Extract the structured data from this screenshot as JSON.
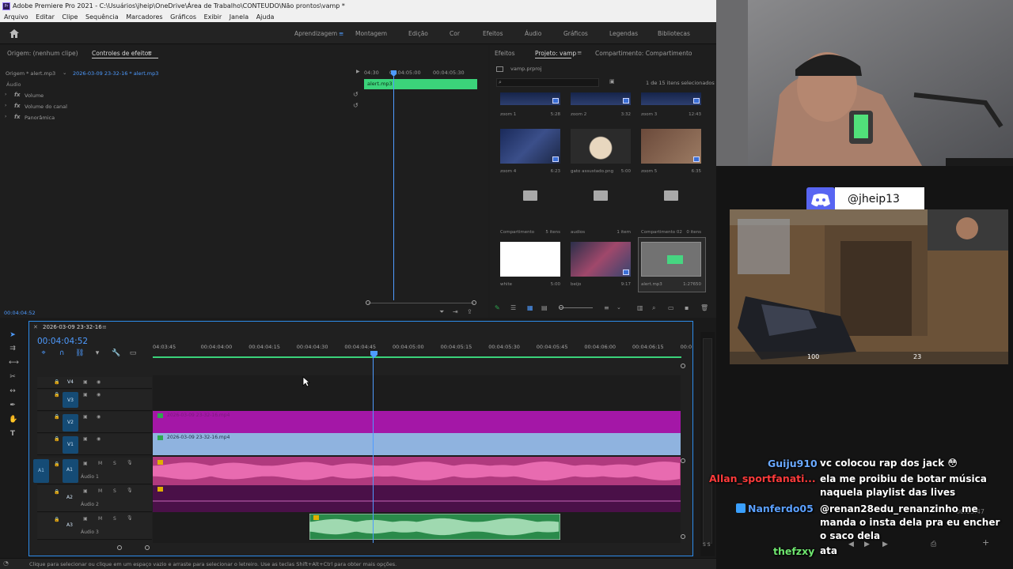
{
  "window": {
    "title": "Adobe Premiere Pro 2021 - C:\\Usuários\\jheip\\OneDrive\\Área de Trabalho\\CONTEUDO\\Não prontos\\vamp *",
    "icon": "Pr"
  },
  "menu": [
    "Arquivo",
    "Editar",
    "Clipe",
    "Sequência",
    "Marcadores",
    "Gráficos",
    "Exibir",
    "Janela",
    "Ajuda"
  ],
  "workspaces": {
    "items": [
      "Aprendizagem",
      "Montagem",
      "Edição",
      "Cor",
      "Efeitos",
      "Áudio",
      "Gráficos",
      "Legendas",
      "Bibliotecas"
    ],
    "active": "Aprendizagem"
  },
  "effect_controls": {
    "source_tab": "Origem: (nenhum clipe)",
    "active_tab": "Controles de efeitos",
    "source_label": "Origem * alert.mp3",
    "sequence_label": "2026-03-09 23-32-16 * alert.mp3",
    "section": "Áudio",
    "rows": [
      "Volume",
      "Volume do canal",
      "Panorâmica"
    ],
    "ruler": [
      "04:30",
      "00:04:05:00",
      "00:04:05:30"
    ],
    "clip_label": "alert.mp3",
    "timecode": "00:04:04:52"
  },
  "project": {
    "tabs": [
      "Efeitos",
      "Projeto: vamp",
      "Compartimento: Compartimento"
    ],
    "active_tab": "Projeto: vamp",
    "file": "vamp.prproj",
    "selection": "1 de 15 itens selecionados",
    "items": [
      {
        "name": "zoom 1",
        "meta": "5:28"
      },
      {
        "name": "zoom 2",
        "meta": "3:32"
      },
      {
        "name": "zoom 3",
        "meta": "12:43"
      },
      {
        "name": "zoom 4",
        "meta": "6:23"
      },
      {
        "name": "gato assustado.png",
        "meta": "5:00"
      },
      {
        "name": "zoom 5",
        "meta": "6:35"
      },
      {
        "name": "Compartimento",
        "meta": "5 itens"
      },
      {
        "name": "audios",
        "meta": "1 item"
      },
      {
        "name": "Compartimento 02",
        "meta": "0 itens"
      },
      {
        "name": "white",
        "meta": "5:00"
      },
      {
        "name": "beijo",
        "meta": "9:17"
      },
      {
        "name": "alert.mp3",
        "meta": "1:27650"
      }
    ]
  },
  "timeline": {
    "sequence": "2026-03-09 23-32-16",
    "timecode": "00:04:04:52",
    "ruler": [
      "04:03:45",
      "00:04:04:00",
      "00:04:04:15",
      "00:04:04:30",
      "00:04:04:45",
      "00:04:05:00",
      "00:04:05:15",
      "00:04:05:30",
      "00:04:05:45",
      "00:04:06:00",
      "00:04:06:15",
      "00:0"
    ],
    "video_tracks": [
      "V4",
      "V3",
      "V2",
      "V1"
    ],
    "audio_tracks": [
      {
        "id": "A1",
        "name": "Áudio 1"
      },
      {
        "id": "A2",
        "name": "Áudio 2"
      },
      {
        "id": "A3",
        "name": "Áudio 3"
      }
    ],
    "clips": {
      "v2": "2026-03-09 23-32-16.mp4",
      "v1": "2026-03-09 23-32-16.mp4"
    },
    "track_buttons": {
      "mute": "M",
      "solo": "S",
      "source": "A1"
    },
    "meter_label": "S S"
  },
  "status": "Clique para selecionar ou clique em um espaço vazio e arraste para selecionar o letreiro. Use as teclas Shift+Alt+Ctrl para obter mais opções.",
  "stream": {
    "discord_handle": "@jheip13",
    "game_hud": {
      "health": "100",
      "ammo": "23"
    },
    "chat": [
      {
        "user": "Guiju910",
        "message": "vc colocou rap dos jack 😳",
        "color": "#6aa9ff"
      },
      {
        "user": "Allan_sportfanati...",
        "message": "ela me proibiu de botar música naquela playlist das lives",
        "color": "#ff3b3b"
      },
      {
        "user": "Nanferdo05",
        "message": "@renan28edu_renanzinho me manda o insta dela pra eu encher o saco dela",
        "color": "#5ba0ff"
      },
      {
        "user": "thefzxy",
        "message": "ata",
        "color": "#6fe66f"
      }
    ],
    "overlay_time": "00:03:47"
  },
  "colors": {
    "accent": "#2d8ceb",
    "clip_video_v2": "#a417a7",
    "clip_video_v1": "#8fb3df",
    "clip_audio": "#c8428a",
    "clip_green": "#2a8a4a"
  }
}
